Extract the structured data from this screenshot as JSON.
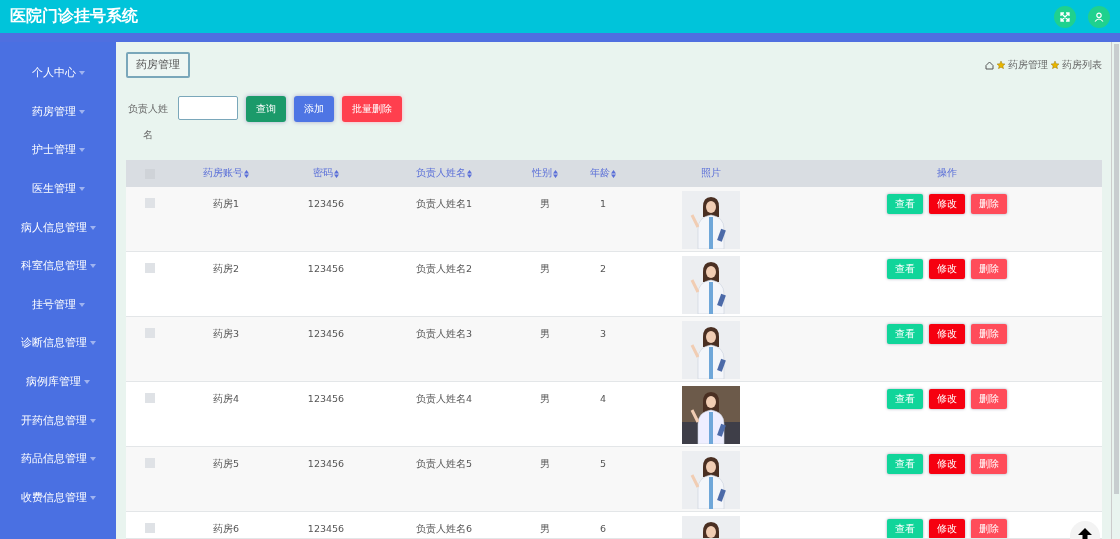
{
  "header": {
    "title": "医院门诊挂号系统"
  },
  "sidebar": {
    "items": [
      {
        "label": "个人中心"
      },
      {
        "label": "药房管理"
      },
      {
        "label": "护士管理"
      },
      {
        "label": "医生管理"
      },
      {
        "label": "病人信息管理"
      },
      {
        "label": "科室信息管理"
      },
      {
        "label": "挂号管理"
      },
      {
        "label": "诊断信息管理"
      },
      {
        "label": "病例库管理"
      },
      {
        "label": "开药信息管理"
      },
      {
        "label": "药品信息管理"
      },
      {
        "label": "收费信息管理"
      }
    ]
  },
  "page_tab": "药房管理",
  "breadcrumb": [
    "药房管理",
    "药房列表"
  ],
  "search": {
    "label": "负责人姓名",
    "buttons": [
      {
        "label": "查询",
        "kind": "search"
      },
      {
        "label": "添加",
        "kind": "add"
      },
      {
        "label": "批量删除",
        "kind": "delete"
      }
    ]
  },
  "table": {
    "select_all": {
      "checked": false
    },
    "columns": [
      {
        "label": "药房账号",
        "sortable": true
      },
      {
        "label": "密码",
        "sortable": true
      },
      {
        "label": "负责人姓名",
        "sortable": true
      },
      {
        "label": "性别",
        "sortable": true
      },
      {
        "label": "年龄",
        "sortable": true
      },
      {
        "label": "照片",
        "sortable": false
      },
      {
        "label": "操作",
        "sortable": false
      }
    ],
    "rows": [
      {
        "checked": false,
        "cells": [
          "药房1",
          "123456",
          "负责人姓名1",
          "男",
          "1"
        ],
        "photo": {
          "kind": "picture"
        },
        "actions": [
          "查看",
          "修改",
          "删除"
        ]
      },
      {
        "checked": false,
        "cells": [
          "药房2",
          "123456",
          "负责人姓名2",
          "男",
          "2"
        ],
        "photo": {
          "kind": "picture"
        },
        "actions": [
          "查看",
          "修改",
          "删除"
        ]
      },
      {
        "checked": false,
        "cells": [
          "药房3",
          "123456",
          "负责人姓名3",
          "男",
          "3"
        ],
        "photo": {
          "kind": "picture"
        },
        "actions": [
          "查看",
          "修改",
          "删除"
        ]
      },
      {
        "checked": false,
        "cells": [
          "药房4",
          "123456",
          "负责人姓名4",
          "男",
          "4"
        ],
        "photo": {
          "kind": "picture"
        },
        "actions": [
          "查看",
          "修改",
          "删除"
        ]
      },
      {
        "checked": false,
        "cells": [
          "药房5",
          "123456",
          "负责人姓名5",
          "男",
          "5"
        ],
        "photo": {
          "kind": "picture"
        },
        "actions": [
          "查看",
          "修改",
          "删除"
        ]
      },
      {
        "checked": false,
        "cells": [
          "药房6",
          "123456",
          "负责人姓名6",
          "男",
          "6"
        ],
        "photo": {
          "kind": "picture"
        },
        "actions": [
          "查看",
          "修改",
          "删除"
        ]
      }
    ]
  }
}
